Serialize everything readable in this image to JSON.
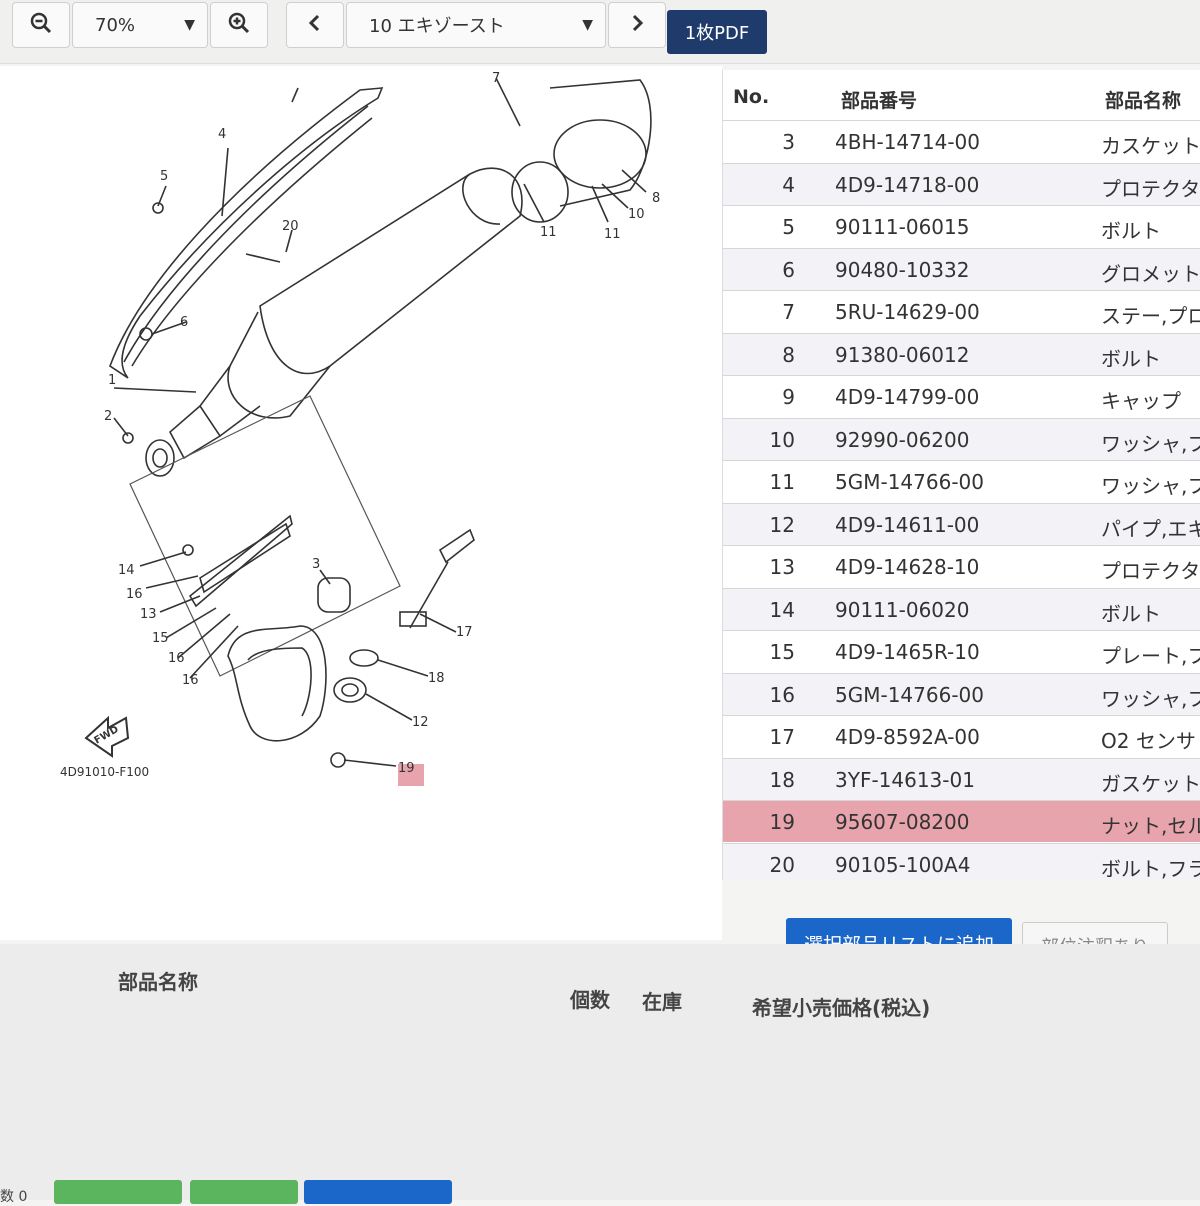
{
  "toolbar": {
    "zoom": "70%",
    "page_select": "10 エキゾースト",
    "pdf_label": "1枚PDF"
  },
  "diagram": {
    "code": "4D91010-F100",
    "fwd": "FWD",
    "callouts": [
      "1",
      "2",
      "3",
      "4",
      "5",
      "6",
      "7",
      "8",
      "10",
      "11",
      "11",
      "12",
      "13",
      "14",
      "15",
      "16",
      "16",
      "16",
      "17",
      "18",
      "19",
      "20"
    ]
  },
  "table": {
    "headers": {
      "no": "No.",
      "part_number": "部品番号",
      "part_name": "部品名称"
    },
    "rows": [
      {
        "no": "3",
        "pn": "4BH-14714-00",
        "name": "カスケット"
      },
      {
        "no": "4",
        "pn": "4D9-14718-00",
        "name": "プロテクタ"
      },
      {
        "no": "5",
        "pn": "90111-06015",
        "name": "ボルト"
      },
      {
        "no": "6",
        "pn": "90480-10332",
        "name": "グロメット"
      },
      {
        "no": "7",
        "pn": "5RU-14629-00",
        "name": "ステー,プロ"
      },
      {
        "no": "8",
        "pn": "91380-06012",
        "name": "ボルト"
      },
      {
        "no": "9",
        "pn": "4D9-14799-00",
        "name": "キャップ"
      },
      {
        "no": "10",
        "pn": "92990-06200",
        "name": "ワッシャ,フ"
      },
      {
        "no": "11",
        "pn": "5GM-14766-00",
        "name": "ワッシャ,フ"
      },
      {
        "no": "12",
        "pn": "4D9-14611-00",
        "name": "パイプ,エキ"
      },
      {
        "no": "13",
        "pn": "4D9-14628-10",
        "name": "プロテクタ"
      },
      {
        "no": "14",
        "pn": "90111-06020",
        "name": "ボルト"
      },
      {
        "no": "15",
        "pn": "4D9-1465R-10",
        "name": "プレート,フ"
      },
      {
        "no": "16",
        "pn": "5GM-14766-00",
        "name": "ワッシャ,フ"
      },
      {
        "no": "17",
        "pn": "4D9-8592A-00",
        "name": "O2 センサ"
      },
      {
        "no": "18",
        "pn": "3YF-14613-01",
        "name": "ガスケット"
      },
      {
        "no": "19",
        "pn": "95607-08200",
        "name": "ナット,セル"
      },
      {
        "no": "20",
        "pn": "90105-100A4",
        "name": "ボルト,フラ"
      }
    ],
    "selected_no": "19"
  },
  "actions": {
    "add_label": "選択部品リストに追加",
    "note_label": "部位注釈あり"
  },
  "lower_list": {
    "col_name": "部品名称",
    "col_qty": "個数",
    "col_stock": "在庫",
    "col_price": "希望小売価格(税込)",
    "count_label": "数 0"
  },
  "colors": {
    "accent": "#1b66c9",
    "pdf_button": "#1f3b6b",
    "selected_row": "#e8a4ad"
  }
}
